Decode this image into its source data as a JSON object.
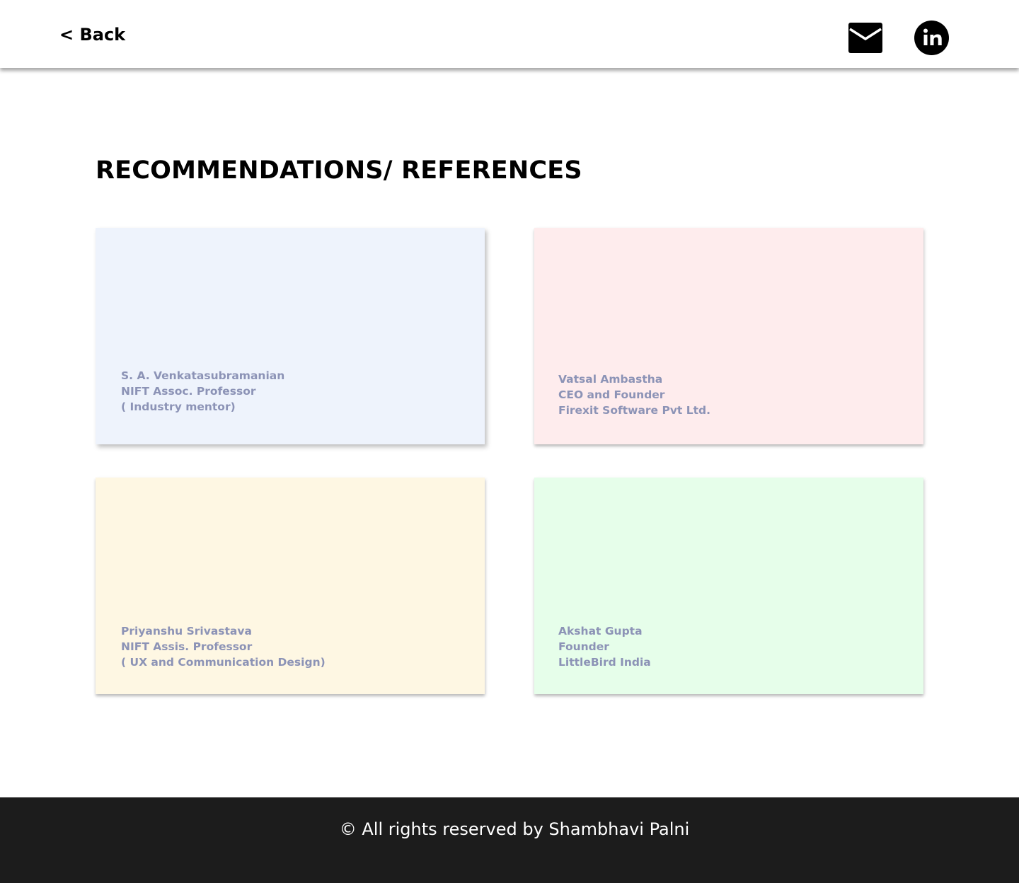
{
  "header": {
    "back_label": "< Back",
    "icons": {
      "mail": "mail-icon",
      "linkedin": "linkedin-icon"
    }
  },
  "main": {
    "title": "RECOMMENDATIONS/ REFERENCES",
    "cards": [
      {
        "background": "#eef3fc",
        "lines": [
          "S. A. Venkatasubramanian",
          "NIFT Assoc. Professor",
          "( Industry mentor)"
        ]
      },
      {
        "background": "#feeced",
        "lines": [
          "Vatsal Ambastha",
          "CEO and Founder",
          "Firexit Software Pvt Ltd."
        ]
      },
      {
        "background": "#fef7e3",
        "lines": [
          "Priyanshu Srivastava",
          "NIFT Assis. Professor",
          "( UX and Communication Design)"
        ]
      },
      {
        "background": "#e6feea",
        "lines": [
          "Akshat Gupta",
          "Founder",
          "LittleBird India"
        ]
      }
    ]
  },
  "footer": {
    "text": "© All rights reserved by Shambhavi Palni",
    "background": "#1c1c1c"
  },
  "colors": {
    "card_text": "#8c93b6",
    "heading": "#000000"
  }
}
